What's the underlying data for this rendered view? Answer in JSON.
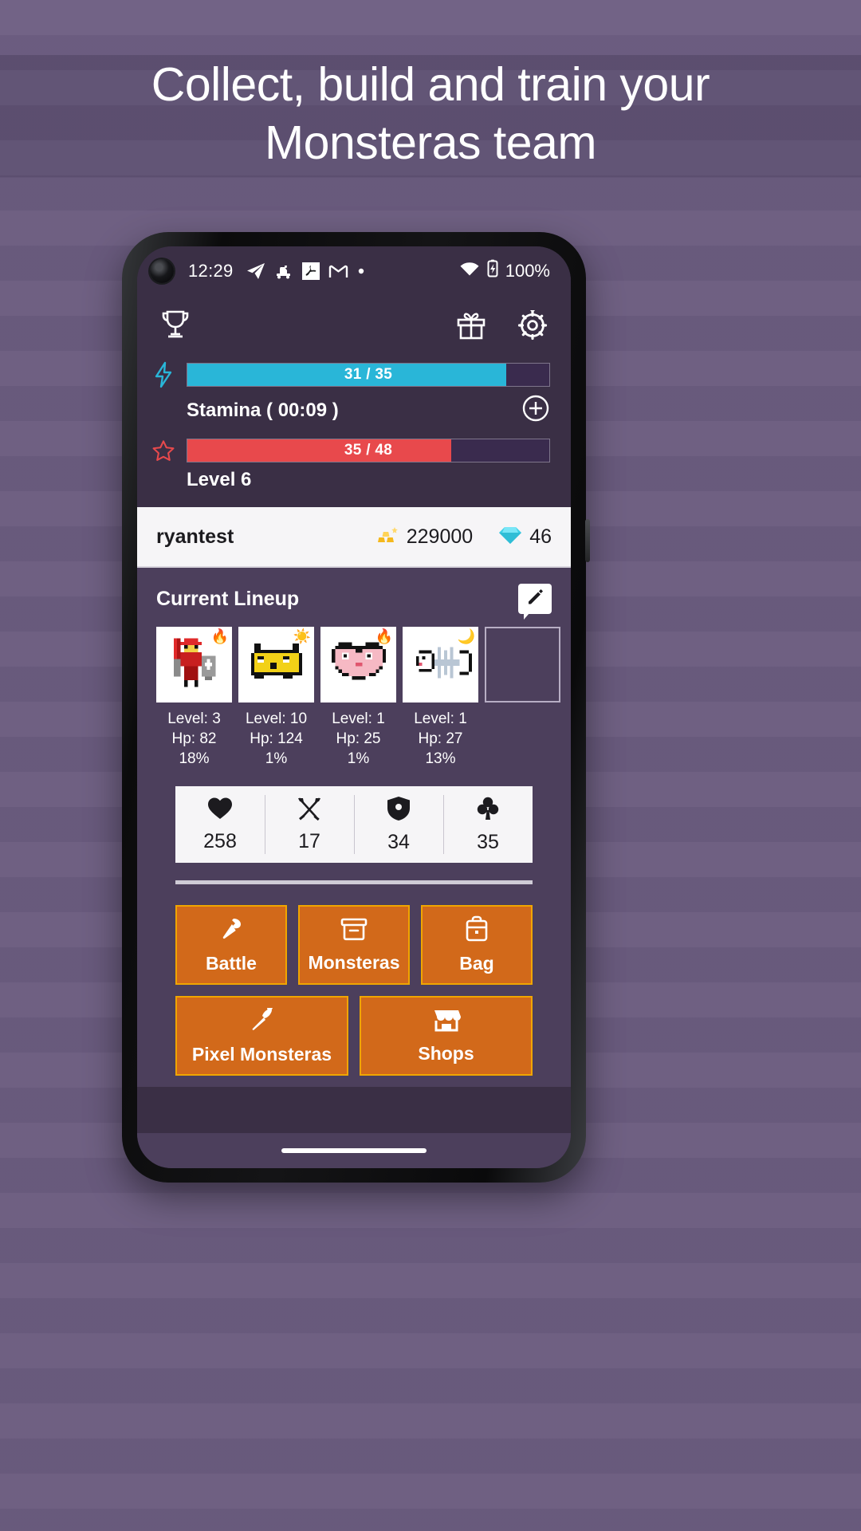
{
  "promo": {
    "headline_line1": "Collect, build and train your",
    "headline_line2": "Monsteras team"
  },
  "statusbar": {
    "time": "12:29",
    "battery_text": "100%",
    "icons": [
      "telegram-icon",
      "train-icon",
      "adobe-acrobat-icon",
      "gmail-icon",
      "dot-icon"
    ],
    "right_icons": [
      "wifi-icon",
      "battery-charging-icon"
    ]
  },
  "app_header": {
    "trophy_label": "trophy-icon",
    "gift_label": "gift-icon",
    "settings_label": "gear-icon"
  },
  "stamina": {
    "icon": "lightning-icon",
    "value_text": "31 / 35",
    "current": 31,
    "max": 35,
    "percent": 88,
    "label": "Stamina ( 00:09 )",
    "color": "#29b6d8",
    "add_icon": "plus-circle-icon"
  },
  "level": {
    "icon": "star-icon",
    "value_text": "35 / 48",
    "current": 35,
    "max": 48,
    "percent": 73,
    "label": "Level 6",
    "color": "#e8494c"
  },
  "user": {
    "name": "ryantest",
    "gold": "229000",
    "gold_icon": "gold-bars-icon",
    "gems": "46",
    "gems_icon": "gem-icon"
  },
  "lineup": {
    "title": "Current Lineup",
    "edit_icon": "edit-pencil-icon",
    "monsters": [
      {
        "sprite": "red-knight-sprite",
        "element": "fire-icon",
        "element_glyph": "🔥",
        "level": "Level: 3",
        "hp": "Hp: 82",
        "pct": "18%"
      },
      {
        "sprite": "yellow-blob-sprite",
        "element": "sun-icon",
        "element_glyph": "☀️",
        "level": "Level: 10",
        "hp": "Hp: 124",
        "pct": "1%"
      },
      {
        "sprite": "pink-heart-sprite",
        "element": "fire-icon",
        "element_glyph": "🔥",
        "level": "Level: 1",
        "hp": "Hp: 25",
        "pct": "1%"
      },
      {
        "sprite": "fish-bone-sprite",
        "element": "moon-icon",
        "element_glyph": "🌙",
        "level": "Level: 1",
        "hp": "Hp: 27",
        "pct": "13%"
      }
    ],
    "empty_slot_label": "empty-lineup-slot"
  },
  "totals": [
    {
      "icon": "heart-icon",
      "value": "258"
    },
    {
      "icon": "crossed-swords-icon",
      "value": "17"
    },
    {
      "icon": "shield-icon",
      "value": "34"
    },
    {
      "icon": "clover-icon",
      "value": "35"
    }
  ],
  "actions": {
    "row1": [
      {
        "icon": "axe-icon",
        "label": "Battle"
      },
      {
        "icon": "archive-box-icon",
        "label": "Monsteras"
      },
      {
        "icon": "backpack-icon",
        "label": "Bag"
      }
    ],
    "row2": [
      {
        "icon": "pickaxe-icon",
        "label": "Pixel Monsteras"
      },
      {
        "icon": "store-icon",
        "label": "Shops"
      }
    ]
  },
  "colors": {
    "accent_orange": "#d2691a",
    "accent_orange_border": "#f0a500",
    "stamina_teal": "#29b6d8",
    "level_red": "#e8494c",
    "app_bg": "#4c3f5c",
    "header_bg": "#3a2f45"
  }
}
